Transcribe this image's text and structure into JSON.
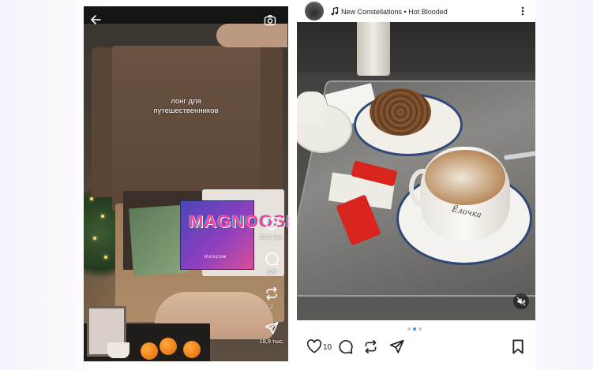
{
  "reel": {
    "caption_lines": [
      "лонг для",
      "путешественников"
    ],
    "magazine_title": "MAGNOOSM",
    "magazine_subtitle": "moscow",
    "actions": {
      "likes": "35,8 тыс.",
      "comments": "127",
      "reposts": "2",
      "shares": "18,9 тыс."
    },
    "icons": [
      "back-arrow-icon",
      "camera-icon",
      "heart-icon",
      "comment-icon",
      "repost-icon",
      "send-icon"
    ]
  },
  "post": {
    "song": "New Constellations • Hot Blooded",
    "cup_brand": "Ёлочка",
    "like_count": "10",
    "carousel": {
      "total": 3,
      "active": 2
    },
    "colors": {
      "carousel_active": "#3897f0",
      "carousel_inactive": "#c7c7c7"
    },
    "icons": [
      "music-note-icon",
      "more-icon",
      "mute-icon",
      "heart-icon",
      "comment-icon",
      "repost-icon",
      "send-icon",
      "bookmark-icon"
    ]
  }
}
